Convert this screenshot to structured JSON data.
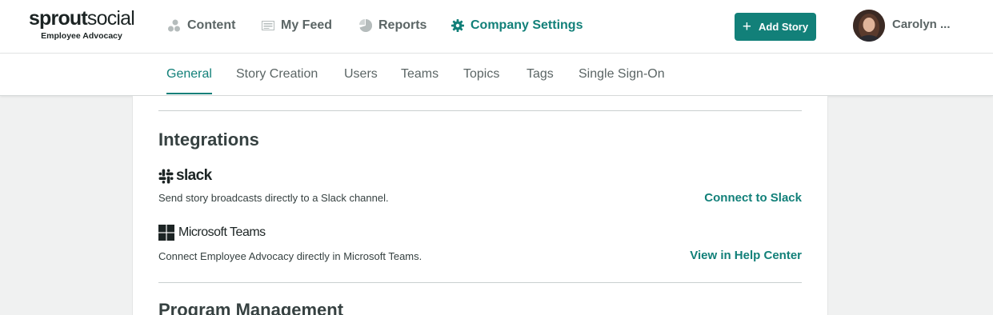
{
  "logo": {
    "main_bold": "sprout",
    "main_light": "social",
    "sub": "Employee Advocacy"
  },
  "nav": {
    "items": [
      {
        "label": "Content",
        "icon": "content-icon"
      },
      {
        "label": "My Feed",
        "icon": "feed-icon"
      },
      {
        "label": "Reports",
        "icon": "reports-icon"
      },
      {
        "label": "Company Settings",
        "icon": "gear-icon",
        "active": true
      }
    ]
  },
  "header": {
    "add_story_label": "Add Story",
    "user_name": "Carolyn ..."
  },
  "subnav": {
    "tabs": [
      {
        "label": "General",
        "active": true
      },
      {
        "label": "Story Creation"
      },
      {
        "label": "Users"
      },
      {
        "label": "Teams"
      },
      {
        "label": "Topics"
      },
      {
        "label": "Tags"
      },
      {
        "label": "Single Sign-On"
      }
    ]
  },
  "integrations": {
    "title": "Integrations",
    "items": [
      {
        "brand": "slack",
        "description": "Send story broadcasts directly to a Slack channel.",
        "action": "Connect to Slack"
      },
      {
        "brand": "Microsoft Teams",
        "description": "Connect Employee Advocacy directly in Microsoft Teams.",
        "action": "View in Help Center"
      }
    ]
  },
  "next_section": {
    "title": "Program Management"
  },
  "colors": {
    "accent": "#128079",
    "text": "#364141",
    "background": "#f0f1f1"
  }
}
